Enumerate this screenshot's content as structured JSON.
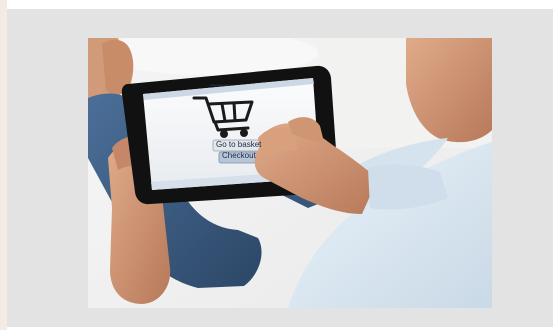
{
  "photo": {
    "subject": "man shopping on tablet",
    "tablet_screen": {
      "header": "Shopping Cart",
      "basket_button": "Go to basket",
      "checkout_button": "Checkout"
    }
  },
  "colors": {
    "panel_bg": "#e3e3e3",
    "tablet_frame": "#111111",
    "screen_bg": "#f4f5f7",
    "shirt": "#dfeaf3",
    "jeans": "#3c5d84",
    "skin": "#c9906f"
  }
}
